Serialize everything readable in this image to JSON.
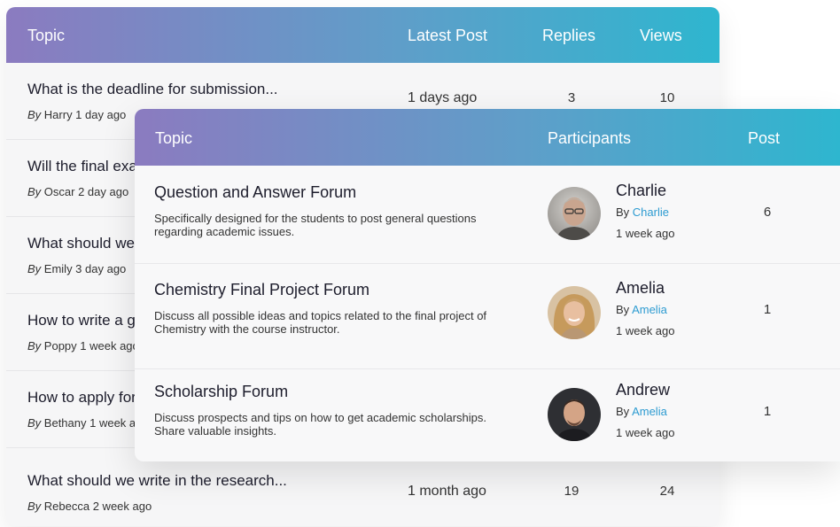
{
  "back_table": {
    "headers": {
      "topic": "Topic",
      "latest_post": "Latest Post",
      "replies": "Replies",
      "views": "Views"
    },
    "rows": [
      {
        "title": "What is the deadline for submission...",
        "by_prefix": "By",
        "by_text": "Harry 1 day ago",
        "latest": "1 days ago",
        "replies": "3",
        "views": "10"
      },
      {
        "title": "Will the final exam be held online...",
        "by_prefix": "By",
        "by_text": "Oscar 2 day ago",
        "latest": "",
        "replies": "",
        "views": ""
      },
      {
        "title": "What should we prepare for the...",
        "by_prefix": "By",
        "by_text": "Emily 3 day ago",
        "latest": "",
        "replies": "",
        "views": ""
      },
      {
        "title": "How to write a good research...",
        "by_prefix": "By",
        "by_text": "Poppy 1 week ago",
        "latest": "",
        "replies": "",
        "views": ""
      },
      {
        "title": "How to apply for the scholarship...",
        "by_prefix": "By",
        "by_text": "Bethany 1 week ago",
        "latest": "",
        "replies": "",
        "views": ""
      },
      {
        "title": "What should we write in the research...",
        "by_prefix": "By",
        "by_text": "Rebecca 2 week ago",
        "latest": "1 month ago",
        "replies": "19",
        "views": "24"
      }
    ]
  },
  "front_table": {
    "headers": {
      "topic": "Topic",
      "participants": "Participants",
      "post": "Post"
    },
    "rows": [
      {
        "title": "Question and Answer Forum",
        "desc": "Specifically designed for the students to post general questions regarding academic issues.",
        "name": "Charlie",
        "by_prefix": "By",
        "by_link": "Charlie",
        "time": "1 week ago",
        "post": "6"
      },
      {
        "title": "Chemistry Final Project Forum",
        "desc": "Discuss all possible ideas and topics related to the final project of Chemistry with the course instructor.",
        "name": "Amelia",
        "by_prefix": "By",
        "by_link": "Amelia",
        "time": "1 week ago",
        "post": "1"
      },
      {
        "title": "Scholarship Forum",
        "desc": "Discuss prospects and tips on how to get academic scholarships. Share valuable insights.",
        "name": "Andrew",
        "by_prefix": "By",
        "by_link": "Amelia",
        "time": "1 week ago",
        "post": "1"
      }
    ]
  },
  "colors": {
    "header_gradient_start": "#8b7bc0",
    "header_gradient_end": "#2eb6cf",
    "link": "#2d9bd1"
  }
}
